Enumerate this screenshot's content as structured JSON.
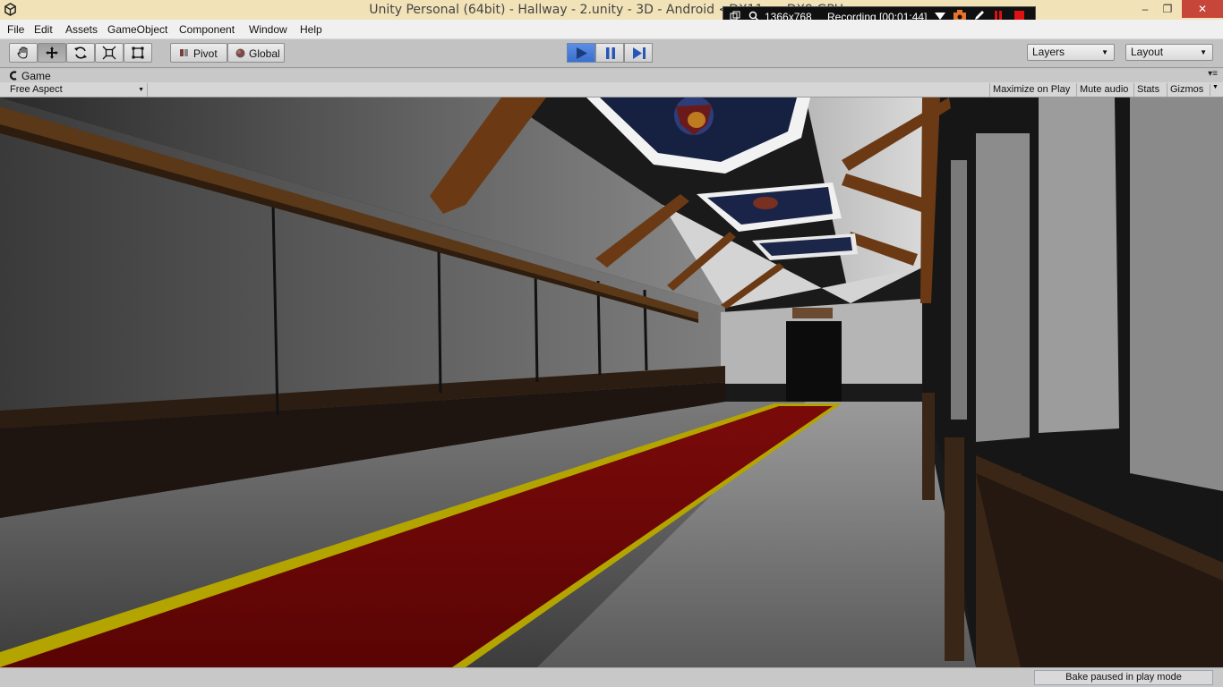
{
  "window": {
    "title": "Unity Personal (64bit) - Hallway - 2.unity - 3D - Android <DX11 on DX9 GPU>",
    "minimize": "–",
    "restore": "❐",
    "close": "✕"
  },
  "recorder": {
    "resolution": "1366x768",
    "status": "Recording [00:01:44]"
  },
  "menu": [
    "File",
    "Edit",
    "Assets",
    "GameObject",
    "Component",
    "Window",
    "Help"
  ],
  "toolbar": {
    "tools": [
      "hand-tool",
      "move-tool",
      "rotate-tool",
      "scale-tool",
      "rect-tool"
    ],
    "pivot_label": "Pivot",
    "global_label": "Global",
    "layers_label": "Layers",
    "layout_label": "Layout"
  },
  "game_view": {
    "tab_label": "Game",
    "aspect_label": "Free Aspect",
    "maximize_label": "Maximize on Play",
    "mute_label": "Mute audio",
    "stats_label": "Stats",
    "gizmos_label": "Gizmos"
  },
  "status": {
    "bake_message": "Bake paused in play mode"
  },
  "colors": {
    "play_active": "#3a6fcf",
    "titlebar": "#f1e2b8",
    "carpet": "#8a0a0a",
    "carpet_trim": "#b8a800",
    "beam": "#6b3a14"
  }
}
